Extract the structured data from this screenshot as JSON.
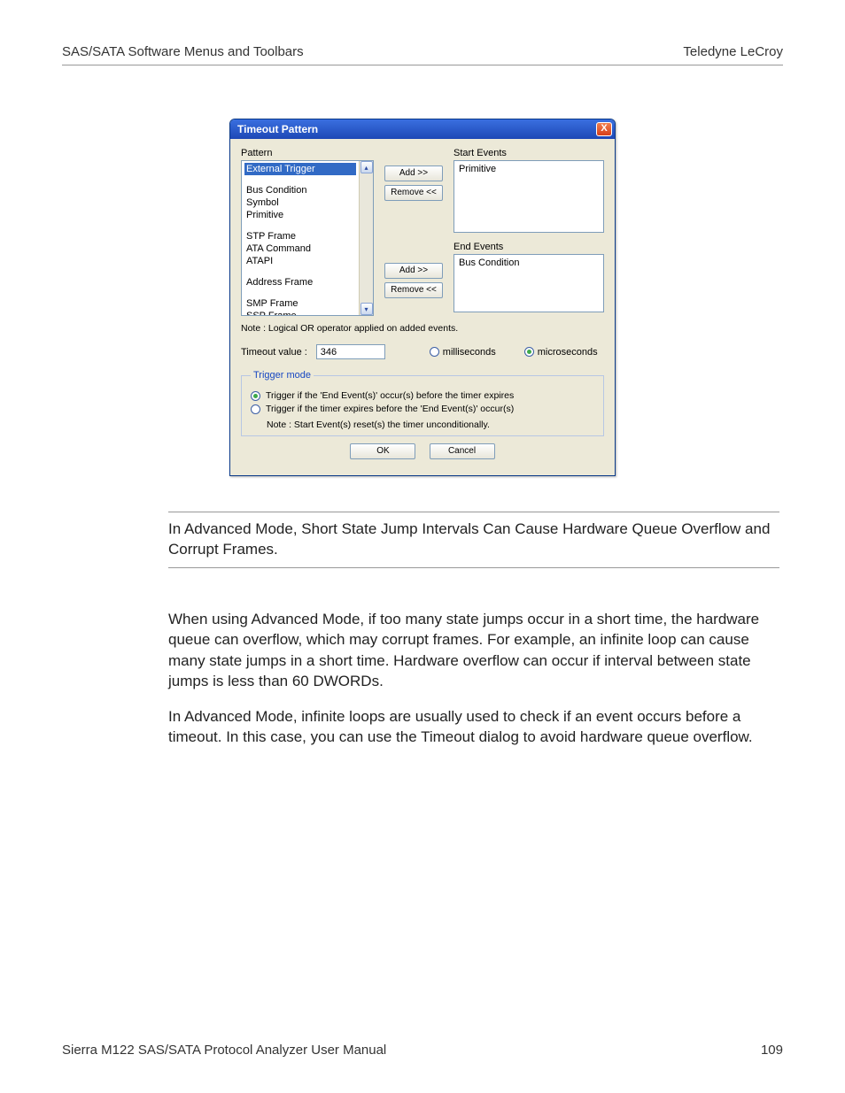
{
  "header": {
    "left": "SAS/SATA Software Menus and Toolbars",
    "right": "Teledyne LeCroy"
  },
  "footer": {
    "left": "Sierra M122 SAS/SATA Protocol Analyzer User Manual",
    "right": "109"
  },
  "dialog": {
    "title": "Timeout Pattern",
    "close": "X",
    "pattern_label": "Pattern",
    "patterns": [
      "External Trigger",
      "",
      "Bus Condition",
      "Symbol",
      "Primitive",
      "",
      "STP Frame",
      "ATA Command",
      "ATAPI",
      "",
      "Address Frame",
      "",
      "SMP Frame",
      "SSP Frame"
    ],
    "selected_index": 0,
    "start_label": "Start Events",
    "start_items": [
      "Primitive"
    ],
    "end_label": "End Events",
    "end_items": [
      "Bus Condition"
    ],
    "add": "Add >>",
    "remove": "Remove <<",
    "note": "Note : Logical OR operator applied on added events.",
    "timeout_label": "Timeout value :",
    "timeout_value": "346",
    "unit_ms": "milliseconds",
    "unit_us": "microseconds",
    "unit_selected": "us",
    "trigger_legend": "Trigger mode",
    "trigger_opt1": "Trigger if the 'End Event(s)' occur(s) before the timer expires",
    "trigger_opt2": "Trigger if the timer expires before the 'End Event(s)' occur(s)",
    "trigger_selected": 0,
    "trigger_note": "Note : Start Event(s) reset(s) the timer unconditionally.",
    "ok": "OK",
    "cancel": "Cancel"
  },
  "callout": "In Advanced Mode, Short State Jump Intervals Can Cause Hardware Queue Overflow and Corrupt Frames.",
  "para1": "When using Advanced Mode, if too many state jumps occur in a short time, the hardware queue can overflow, which may corrupt frames. For example, an infinite loop can cause many state jumps in a short time. Hardware overflow can occur if interval between state jumps is less than 60 DWORDs.",
  "para2": "In Advanced Mode, infinite loops are usually used to check if an event occurs before a timeout. In this case, you can use the Timeout dialog to avoid hardware queue overflow."
}
